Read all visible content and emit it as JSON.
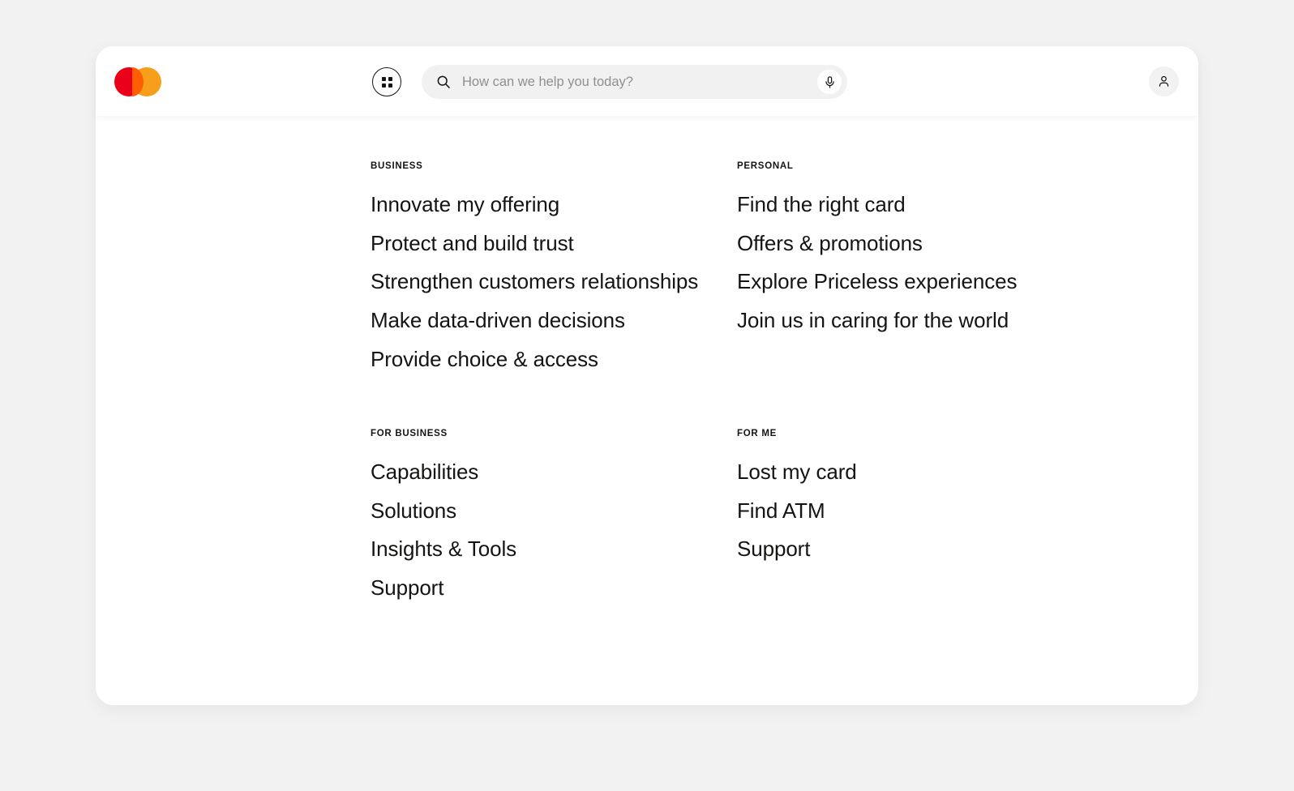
{
  "header": {
    "logo_alt": "Mastercard",
    "logo_colors": {
      "red": "#EB001B",
      "yellow": "#F79E1B",
      "overlap": "#FF5F00"
    },
    "apps_button_label": "Apps",
    "search": {
      "placeholder": "How can we help you today?",
      "value": "",
      "search_icon": "search-icon",
      "mic_icon": "microphone-icon"
    },
    "account_button_label": "Account",
    "account_icon": "person-icon"
  },
  "menu": {
    "columns": [
      {
        "label": "BUSINESS",
        "items": [
          "Innovate my offering",
          "Protect and build trust",
          "Strengthen customers relationships",
          "Make data-driven decisions",
          "Provide choice & access"
        ]
      },
      {
        "label": "PERSONAL",
        "items": [
          "Find the right card",
          "Offers & promotions",
          "Explore Priceless experiences",
          "Join us in caring for the world"
        ]
      },
      {
        "label": "FOR BUSINESS",
        "items": [
          "Capabilities",
          "Solutions",
          "Insights & Tools",
          "Support"
        ]
      },
      {
        "label": "FOR ME",
        "items": [
          "Lost my card",
          "Find ATM",
          "Support"
        ]
      }
    ]
  },
  "theme": {
    "page_background": "#F2F2F2",
    "panel_background": "#FFFFFF",
    "text_color": "#141413",
    "placeholder_color": "#8F8F8F",
    "search_field_background": "#F1F1F1"
  }
}
